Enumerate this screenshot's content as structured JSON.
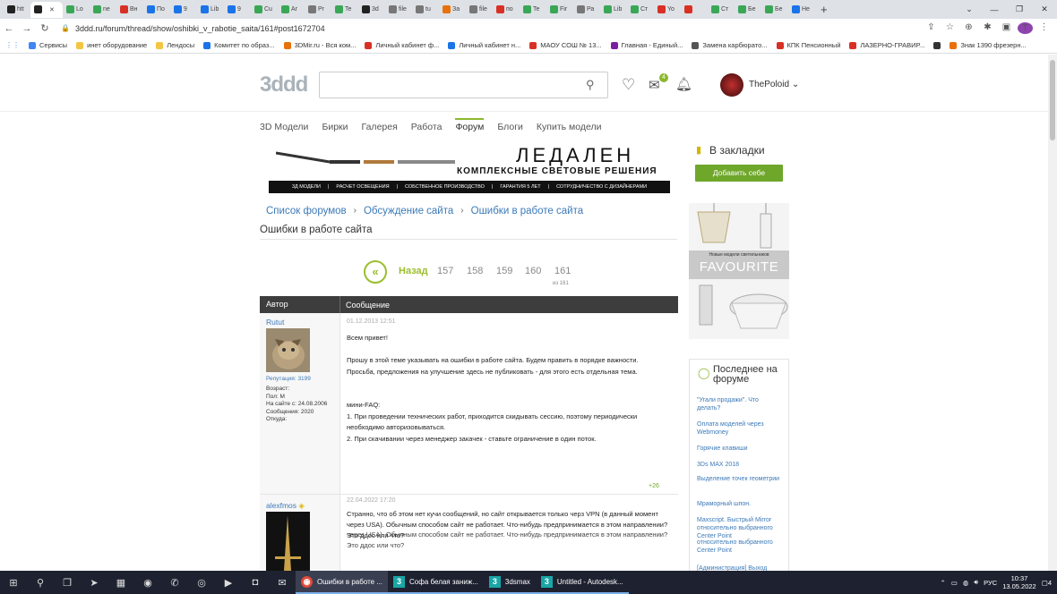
{
  "browser": {
    "tabs": [
      "htt",
      "",
      "Lo",
      "ne",
      "Вн",
      "По",
      "9",
      "Lib",
      "9",
      "Cu",
      "Ar",
      "Pr",
      "Te",
      "3d",
      "file",
      "tu",
      "За",
      "file",
      "по",
      "Te",
      "Fir",
      "Ра",
      "Lib",
      "Ст",
      "Yo",
      "",
      "Ст",
      "Бе",
      "Бе",
      "Не"
    ],
    "tab_colors": [
      "#222",
      "#222",
      "#3aa757",
      "#3aa757",
      "#d93025",
      "#1a73e8",
      "#1a73e8",
      "#1a73e8",
      "#1a73e8",
      "#3aa757",
      "#3aa757",
      "#777",
      "#3aa757",
      "#222",
      "#777",
      "#777",
      "#e8710a",
      "#777",
      "#d93025",
      "#3aa757",
      "#3aa757",
      "#777",
      "#3aa757",
      "#3aa757",
      "#d93025",
      "#d93025",
      "#3aa757",
      "#3aa757",
      "#3aa757",
      "#1a73e8"
    ],
    "url": "3ddd.ru/forum/thread/show/oshibki_v_rabotie_saita/161#post1672704",
    "avatar_letter": "T",
    "bookmarks": [
      {
        "label": "Сервисы",
        "color": "#4285f4"
      },
      {
        "label": "инет оборудование",
        "color": "#f4c542"
      },
      {
        "label": "Лендосы",
        "color": "#f4c542"
      },
      {
        "label": "Комитет по образ...",
        "color": "#1a73e8"
      },
      {
        "label": "3DMir.ru - Вся ком...",
        "color": "#e8710a"
      },
      {
        "label": "Личный кабинет ф...",
        "color": "#d93025"
      },
      {
        "label": "Личный кабинет н...",
        "color": "#1a73e8"
      },
      {
        "label": "МАОУ СОШ № 13...",
        "color": "#d93025"
      },
      {
        "label": "Главная - Единый...",
        "color": "#7b1fa2"
      },
      {
        "label": "Замена карбюрато...",
        "color": "#555"
      },
      {
        "label": "КПК Пенсионный",
        "color": "#d93025"
      },
      {
        "label": "ЛАЗЕРНО-ГРАВИР...",
        "color": "#d93025"
      },
      {
        "label": "",
        "color": "#333"
      },
      {
        "label": "Знак 1390 фрезерн...",
        "color": "#e8710a"
      }
    ]
  },
  "site": {
    "logo": "3ddd",
    "username": "ThePoloid",
    "mail_count": "4",
    "nav": [
      "3D Модели",
      "Бирки",
      "Галерея",
      "Работа",
      "Форум",
      "Блоги",
      "Купить модели"
    ],
    "active_nav_index": 4
  },
  "banner": {
    "brand": "ЛЕДАЛЕН",
    "tagline": "КОМПЛЕКСНЫЕ СВЕТОВЫЕ РЕШЕНИЯ",
    "strip": [
      "3Д МОДЕЛИ",
      "РАСЧЕТ ОСВЕЩЕНИЯ",
      "СОБСТВЕННОЕ ПРОИЗВОДСТВО",
      "ГАРАНТИЯ 5 ЛЕТ",
      "СОТРУДНИЧЕСТВО С ДИЗАЙНЕРАМИ"
    ]
  },
  "breadcrumb": [
    "Список форумов",
    "Обсуждение сайта",
    "Ошибки в работе сайта"
  ],
  "thread_title": "Ошибки в работе сайта",
  "pagination": {
    "back": "Назад",
    "pages": [
      "157",
      "158",
      "159",
      "160",
      "161"
    ],
    "of": "из 161"
  },
  "table": {
    "col_author": "Автор",
    "col_message": "Сообщение"
  },
  "posts": [
    {
      "author": "Rutut",
      "reputation": "Репутация: 3199",
      "meta": [
        "Возраст:",
        "Пол: М",
        "На сайте с: 24.08.2006",
        "Сообщения: 2020",
        "Откуда:"
      ],
      "date": "01.12.2013 12:51",
      "lines": [
        "Всем привет!",
        "",
        "Прошу в этой теме указывать на ошибки в работе сайта. Будем править в порядке важности.",
        "Просьба, предложения на улучшение здесь не публиковать - для этого есть отдельная тема.",
        "",
        "",
        "мини-FAQ:",
        "1. При проведении технических работ, приходится скидывать сессию, поэтому периодически",
        "необходимо авторизовываться.",
        "2. При скачивании через менеджер закачек - ставьте ограничение в один поток."
      ],
      "votes": "+26"
    },
    {
      "author": "alexfmos",
      "date": "22.04.2022 17:20",
      "lines": [
        "Странно, что об этом нет кучи сообщений, но сайт открывается только черз VPN (в данный момент",
        "через USA). Обычным способом сайт не работает. Что-нибудь предпринимается в этом направлении?",
        "Это ддос или что?"
      ],
      "lines_overlap": [
        "через USA). Обычным способом сайт не работает. Что-нибудь предпринимается в этом направлении?",
        "Это ддос или что?"
      ]
    }
  ],
  "sidebar": {
    "bookmark_title": "В закладки",
    "add_button": "Добавить себе",
    "ad_small": "Новые модели светильников",
    "ad_brand": "FAVOURITE",
    "latest_title": "Последнее на форуме",
    "latest_items": [
      "\"Угали продажи\". Что делать?",
      "Оплата моделей через Webmoney",
      "Горячие клавиши",
      "3Ds MAX 2018",
      "Выделение точек геометрии",
      "Мраморный шпон.",
      "Maxscript. Быстрый Mirror относительно выбранного Center Point",
      "относительно выбранного Center Point",
      "[Администрация] Выход"
    ]
  },
  "taskbar": {
    "apps": [
      "Ошибки в работе ...",
      "Софа белая заниж...",
      "3dsmax",
      "Untitled - Autodesk..."
    ],
    "lang": "РУС",
    "time": "10:37",
    "date": "13.05.2022",
    "notif": "4"
  }
}
